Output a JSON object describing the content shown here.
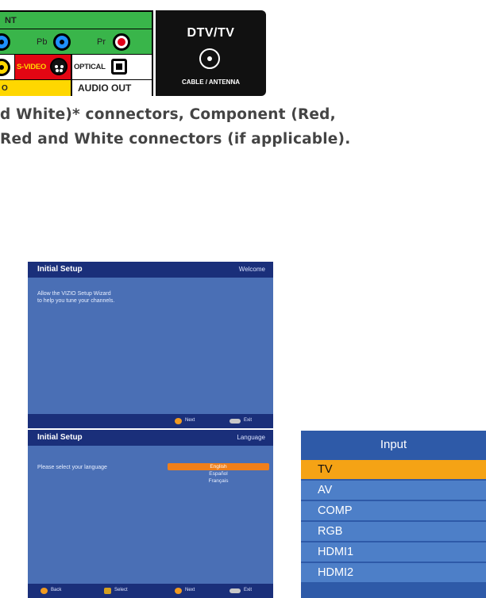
{
  "connector_panel": {
    "top_label": "NT",
    "component_labels": [
      "Pb",
      "Pr"
    ],
    "svideo_label": "S-VIDEO",
    "optical_label": "OPTICAL",
    "bottom_left_label": "O",
    "audio_out_label": "AUDIO OUT",
    "dtv_title": "DTV/TV",
    "cable_label": "CABLE / ANTENNA"
  },
  "document": {
    "line1": "d White)* connectors, Component (Red,",
    "line2": "Red and White connectors (if applicable)."
  },
  "setup_welcome": {
    "title": "Initial  Setup",
    "right_label": "Welcome",
    "body_line1": "Allow the VIZIO Setup Wizard",
    "body_line2": "to help you tune your channels.",
    "footer_next": "Next",
    "footer_exit": "Exit"
  },
  "setup_language": {
    "title": "Initial  Setup",
    "right_label": "Language",
    "prompt": "Please select your language",
    "languages": [
      "English",
      "Español",
      "Français"
    ],
    "footer_back": "Back",
    "footer_select": "Select",
    "footer_next": "Next",
    "footer_exit": "Exit"
  },
  "input_menu": {
    "title": "Input",
    "items": [
      "TV",
      "AV",
      "COMP",
      "RGB",
      "HDMI1",
      "HDMI2"
    ],
    "selected": "TV"
  },
  "colors": {
    "panel_green": "#39b54a",
    "tv_blue": "#4a6fb5",
    "tv_header": "#1a2f7a",
    "highlight_orange": "#f07f1a",
    "input_highlight": "#f5a315"
  }
}
